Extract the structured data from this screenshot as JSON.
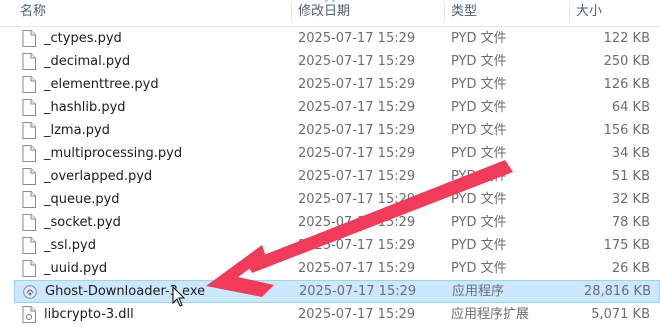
{
  "header": {
    "name": "名称",
    "date": "修改日期",
    "type": "类型",
    "size": "大小"
  },
  "files": [
    {
      "name": "_ctypes.pyd",
      "date": "2025-07-17 15:29",
      "type": "PYD 文件",
      "size": "122 KB",
      "icon": "file-icon"
    },
    {
      "name": "_decimal.pyd",
      "date": "2025-07-17 15:29",
      "type": "PYD 文件",
      "size": "250 KB",
      "icon": "file-icon"
    },
    {
      "name": "_elementtree.pyd",
      "date": "2025-07-17 15:29",
      "type": "PYD 文件",
      "size": "126 KB",
      "icon": "file-icon"
    },
    {
      "name": "_hashlib.pyd",
      "date": "2025-07-17 15:29",
      "type": "PYD 文件",
      "size": "64 KB",
      "icon": "file-icon"
    },
    {
      "name": "_lzma.pyd",
      "date": "2025-07-17 15:29",
      "type": "PYD 文件",
      "size": "156 KB",
      "icon": "file-icon"
    },
    {
      "name": "_multiprocessing.pyd",
      "date": "2025-07-17 15:29",
      "type": "PYD 文件",
      "size": "34 KB",
      "icon": "file-icon"
    },
    {
      "name": "_overlapped.pyd",
      "date": "2025-07-17 15:29",
      "type": "PYD 文件",
      "size": "51 KB",
      "icon": "file-icon"
    },
    {
      "name": "_queue.pyd",
      "date": "2025-07-17 15:29",
      "type": "PYD 文件",
      "size": "32 KB",
      "icon": "file-icon"
    },
    {
      "name": "_socket.pyd",
      "date": "2025-07-17 15:29",
      "type": "PYD 文件",
      "size": "78 KB",
      "icon": "file-icon"
    },
    {
      "name": "_ssl.pyd",
      "date": "2025-07-17 15:29",
      "type": "PYD 文件",
      "size": "175 KB",
      "icon": "file-icon"
    },
    {
      "name": "_uuid.pyd",
      "date": "2025-07-17 15:29",
      "type": "PYD 文件",
      "size": "26 KB",
      "icon": "file-icon"
    },
    {
      "name": "Ghost-Downloader-3.exe",
      "date": "2025-07-17 15:29",
      "type": "应用程序",
      "size": "28,816 KB",
      "icon": "exe-icon",
      "selected": true
    },
    {
      "name": "libcrypto-3.dll",
      "date": "2025-07-17 15:29",
      "type": "应用程序扩展",
      "size": "5,071 KB",
      "icon": "dll-icon"
    }
  ],
  "colors": {
    "selection": "#cce8ff",
    "selection_border": "#99d1ff",
    "annotation_arrow": "#f03c5a",
    "header_text": "#4c607a"
  }
}
